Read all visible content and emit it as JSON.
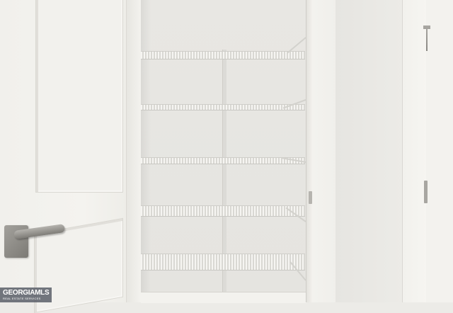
{
  "photo": {
    "subject": "walk-in closet with wire shelves",
    "wire_shelf_count": 5
  },
  "watermark": {
    "main": "GEORGIAMLS",
    "sub": "REAL ESTATE SERVICES"
  },
  "colors": {
    "wall": "#ecebe7",
    "door": "#f3f2ee",
    "hardware": "#8a8883"
  }
}
